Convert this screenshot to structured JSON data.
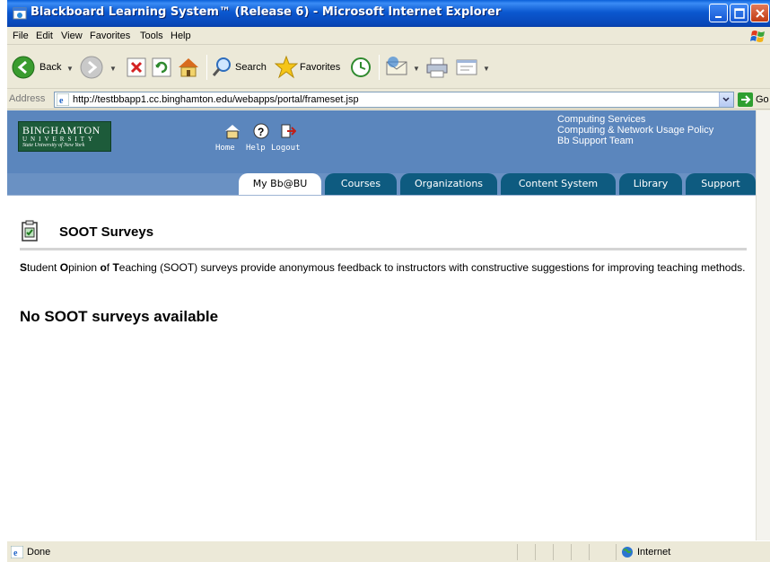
{
  "window": {
    "title": "Blackboard Learning System™ (Release 6) - Microsoft Internet Explorer"
  },
  "menubar": {
    "items": [
      "File",
      "Edit",
      "View",
      "Favorites",
      "Tools",
      "Help"
    ]
  },
  "toolbar": {
    "back_label": "Back",
    "search_label": "Search",
    "favorites_label": "Favorites"
  },
  "address": {
    "label": "Address",
    "url": "http://testbbapp1.cc.binghamton.edu/webapps/portal/frameset.jsp",
    "go_label": "Go"
  },
  "logo": {
    "line1": "BINGHAMTON",
    "line2": "UNIVERSITY",
    "line3": "State University of New York"
  },
  "bbnav": {
    "home_label": "Home",
    "help_label": "Help",
    "logout_label": "Logout"
  },
  "toplinks": [
    "Computing Services",
    "Computing & Network Usage Policy",
    "Bb Support Team"
  ],
  "tabs": [
    {
      "label": "My Bb@BU",
      "active": true
    },
    {
      "label": "Courses",
      "active": false
    },
    {
      "label": "Organizations",
      "active": false
    },
    {
      "label": "Content System",
      "active": false
    },
    {
      "label": "Library",
      "active": false
    },
    {
      "label": "Support",
      "active": false
    }
  ],
  "page": {
    "title": "SOOT Surveys",
    "desc_s": "S",
    "desc_1": "tudent ",
    "desc_o": "O",
    "desc_2": "pinion ",
    "desc_of": "o",
    "desc_3": "f ",
    "desc_t": "T",
    "desc_4": "eaching (SOOT) surveys provide anonymous feedback to instructors with constructive suggestions for improving teaching methods.",
    "empty_message": "No SOOT surveys available"
  },
  "status": {
    "text": "Done",
    "zone": "Internet"
  }
}
